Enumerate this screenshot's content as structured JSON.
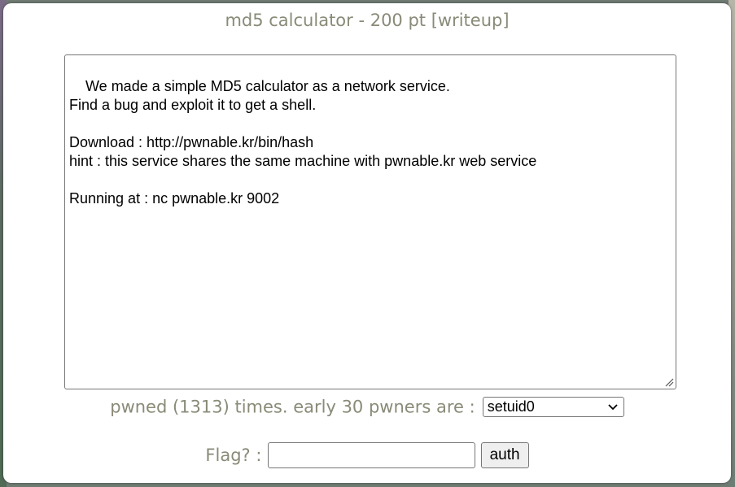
{
  "challenge": {
    "title": "md5 calculator - 200 pt [writeup]",
    "description": "We made a simple MD5 calculator as a network service.\nFind a bug and exploit it to get a shell.\n\nDownload : http://pwnable.kr/bin/hash\nhint : this service shares the same machine with pwnable.kr web service\n\nRunning at : nc pwnable.kr 9002"
  },
  "pwners": {
    "label": "pwned (1313) times. early 30 pwners are :",
    "selected": "setuid0"
  },
  "flag": {
    "label": "Flag? :",
    "value": "",
    "button_label": "auth"
  },
  "icons": {
    "resize": "resize-grip-icon",
    "dropdown": "chevron-down-icon"
  },
  "colors": {
    "label_text": "#8a8a78",
    "button_bg": "#efefef"
  }
}
